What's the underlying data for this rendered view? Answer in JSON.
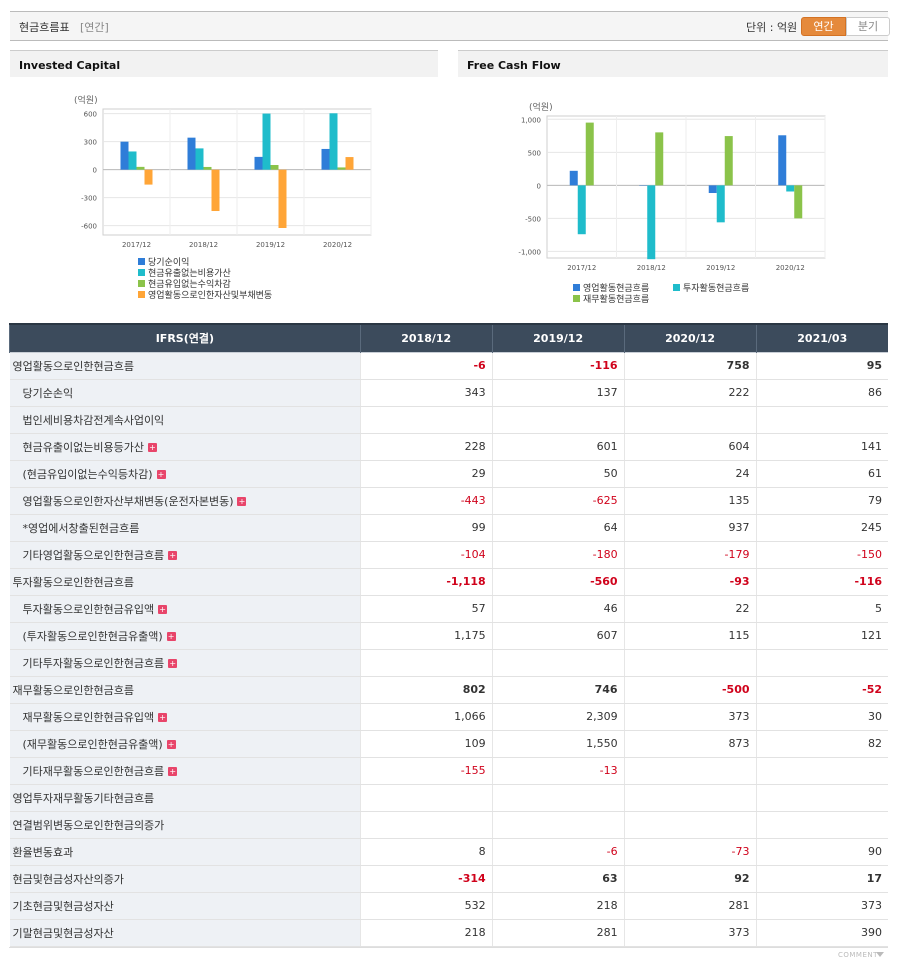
{
  "header": {
    "title": "현금흐름표",
    "sub": "[연간]",
    "unit": "단위 : 억원",
    "tab_annual": "연간",
    "tab_quarter": "분기"
  },
  "chart_titles": {
    "left": "Invested Capital",
    "right": "Free Cash Flow"
  },
  "chart_data": [
    {
      "type": "bar",
      "title": "Invested Capital",
      "ylabel": "(억원)",
      "categories": [
        "2017/12",
        "2018/12",
        "2019/12",
        "2020/12"
      ],
      "ylim": [
        -700,
        650
      ],
      "yticks": [
        600,
        300,
        0,
        -300,
        -600
      ],
      "ytick_labels": [
        "600",
        "300",
        "0",
        "-300",
        "-600"
      ],
      "grid": true,
      "legend": "bottom",
      "series": [
        {
          "name": "당기순이익",
          "color": "#2f7dd8",
          "values": [
            300,
            343,
            137,
            222
          ]
        },
        {
          "name": "현금유출없는비용가산",
          "color": "#1fbccb",
          "values": [
            195,
            228,
            601,
            604
          ]
        },
        {
          "name": "현금유입없는수익차감",
          "color": "#8bc34a",
          "values": [
            30,
            29,
            50,
            24
          ]
        },
        {
          "name": "영업활동으로인한자산및부채변동",
          "color": "#ffa537",
          "values": [
            -160,
            -443,
            -625,
            135
          ]
        }
      ]
    },
    {
      "type": "bar",
      "title": "Free Cash Flow",
      "ylabel": "(억원)",
      "categories": [
        "2017/12",
        "2018/12",
        "2019/12",
        "2020/12"
      ],
      "ylim": [
        -1100,
        1050
      ],
      "yticks": [
        1000,
        500,
        0,
        -500,
        -1000
      ],
      "ytick_labels": [
        "1,000",
        "500",
        "0",
        "-500",
        "-1,000"
      ],
      "grid": true,
      "legend": "bottom",
      "series": [
        {
          "name": "영업활동현금흐름",
          "color": "#2f7dd8",
          "values": [
            220,
            -6,
            -116,
            758
          ]
        },
        {
          "name": "투자활동현금흐름",
          "color": "#1fbccb",
          "values": [
            -740,
            -1118,
            -560,
            -93
          ]
        },
        {
          "name": "재무활동현금흐름",
          "color": "#8bc34a",
          "values": [
            950,
            802,
            746,
            -500
          ]
        }
      ]
    }
  ],
  "table": {
    "header": "IFRS(연결)",
    "columns": [
      "2018/12",
      "2019/12",
      "2020/12",
      "2021/03"
    ],
    "rows": [
      {
        "label": "영업활동으로인한현금흐름",
        "level": "main",
        "plus": false,
        "values": [
          "-6",
          "-116",
          "758",
          "95"
        ]
      },
      {
        "label": "당기순손익",
        "level": "sub",
        "plus": false,
        "values": [
          "343",
          "137",
          "222",
          "86"
        ]
      },
      {
        "label": "법인세비용차감전계속사업이익",
        "level": "sub",
        "plus": false,
        "values": [
          "",
          "",
          "",
          ""
        ]
      },
      {
        "label": "현금유출이없는비용등가산",
        "level": "sub",
        "plus": true,
        "values": [
          "228",
          "601",
          "604",
          "141"
        ]
      },
      {
        "label": "(현금유입이없는수익등차감)",
        "level": "sub",
        "plus": true,
        "values": [
          "29",
          "50",
          "24",
          "61"
        ]
      },
      {
        "label": "영업활동으로인한자산부채변동(운전자본변동)",
        "level": "sub",
        "plus": true,
        "values": [
          "-443",
          "-625",
          "135",
          "79"
        ]
      },
      {
        "label": "*영업에서창출된현금흐름",
        "level": "sub",
        "plus": false,
        "values": [
          "99",
          "64",
          "937",
          "245"
        ]
      },
      {
        "label": "기타영업활동으로인한현금흐름",
        "level": "sub",
        "plus": true,
        "values": [
          "-104",
          "-180",
          "-179",
          "-150"
        ]
      },
      {
        "label": "투자활동으로인한현금흐름",
        "level": "main",
        "plus": false,
        "values": [
          "-1,118",
          "-560",
          "-93",
          "-116"
        ]
      },
      {
        "label": "투자활동으로인한현금유입액",
        "level": "sub",
        "plus": true,
        "values": [
          "57",
          "46",
          "22",
          "5"
        ]
      },
      {
        "label": "(투자활동으로인한현금유출액)",
        "level": "sub",
        "plus": true,
        "values": [
          "1,175",
          "607",
          "115",
          "121"
        ]
      },
      {
        "label": "기타투자활동으로인한현금흐름",
        "level": "sub",
        "plus": true,
        "values": [
          "",
          "",
          "",
          ""
        ]
      },
      {
        "label": "재무활동으로인한현금흐름",
        "level": "main",
        "plus": false,
        "values": [
          "802",
          "746",
          "-500",
          "-52"
        ]
      },
      {
        "label": "재무활동으로인한현금유입액",
        "level": "sub",
        "plus": true,
        "values": [
          "1,066",
          "2,309",
          "373",
          "30"
        ]
      },
      {
        "label": "(재무활동으로인한현금유출액)",
        "level": "sub",
        "plus": true,
        "values": [
          "109",
          "1,550",
          "873",
          "82"
        ]
      },
      {
        "label": "기타재무활동으로인한현금흐름",
        "level": "sub",
        "plus": true,
        "values": [
          "-155",
          "-13",
          "",
          ""
        ]
      },
      {
        "label": "영업투자재무활동기타현금흐름",
        "level": "plain",
        "plus": false,
        "values": [
          "",
          "",
          "",
          ""
        ]
      },
      {
        "label": "연결범위변동으로인한현금의증가",
        "level": "plain",
        "plus": false,
        "values": [
          "",
          "",
          "",
          ""
        ]
      },
      {
        "label": "환율변동효과",
        "level": "plain",
        "plus": false,
        "values": [
          "8",
          "-6",
          "-73",
          "90"
        ]
      },
      {
        "label": "현금및현금성자산의증가",
        "level": "plainbold",
        "plus": false,
        "values": [
          "-314",
          "63",
          "92",
          "17"
        ]
      },
      {
        "label": "기초현금및현금성자산",
        "level": "plain",
        "plus": false,
        "values": [
          "532",
          "218",
          "281",
          "373"
        ]
      },
      {
        "label": "기말현금및현금성자산",
        "level": "plain",
        "plus": false,
        "values": [
          "218",
          "281",
          "373",
          "390"
        ]
      }
    ]
  },
  "footer": {
    "comment": "COMMENT"
  }
}
